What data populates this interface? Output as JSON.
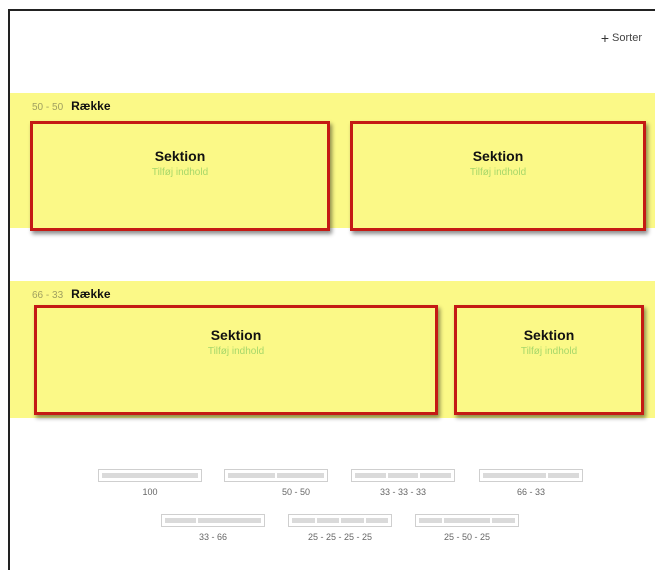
{
  "toolbar": {
    "sorter_label": "Sorter"
  },
  "rows": [
    {
      "ratio": "50 - 50",
      "title": "Række",
      "sections": [
        {
          "title": "Sektion",
          "add": "Tilføj indhold"
        },
        {
          "title": "Sektion",
          "add": "Tilføj indhold"
        }
      ]
    },
    {
      "ratio": "66 - 33",
      "title": "Række",
      "sections": [
        {
          "title": "Sektion",
          "add": "Tilføj indhold"
        },
        {
          "title": "Sektion",
          "add": "Tilføj indhold"
        }
      ]
    }
  ],
  "layouts": [
    {
      "label": "100",
      "columns": [
        100
      ]
    },
    {
      "label": "50 - 50",
      "columns": [
        50,
        50
      ]
    },
    {
      "label": "33 - 33 - 33",
      "columns": [
        33,
        33,
        33
      ]
    },
    {
      "label": "66 - 33",
      "columns": [
        66,
        33
      ]
    },
    {
      "label": "33 - 66",
      "columns": [
        33,
        66
      ]
    },
    {
      "label": "25 - 25 - 25 - 25",
      "columns": [
        25,
        25,
        25,
        25
      ]
    },
    {
      "label": "25 - 50 - 25",
      "columns": [
        25,
        50,
        25
      ]
    }
  ],
  "colors": {
    "row_background": "#fbf987",
    "section_border": "#c41a14",
    "add_content_text": "#a6d76a"
  }
}
